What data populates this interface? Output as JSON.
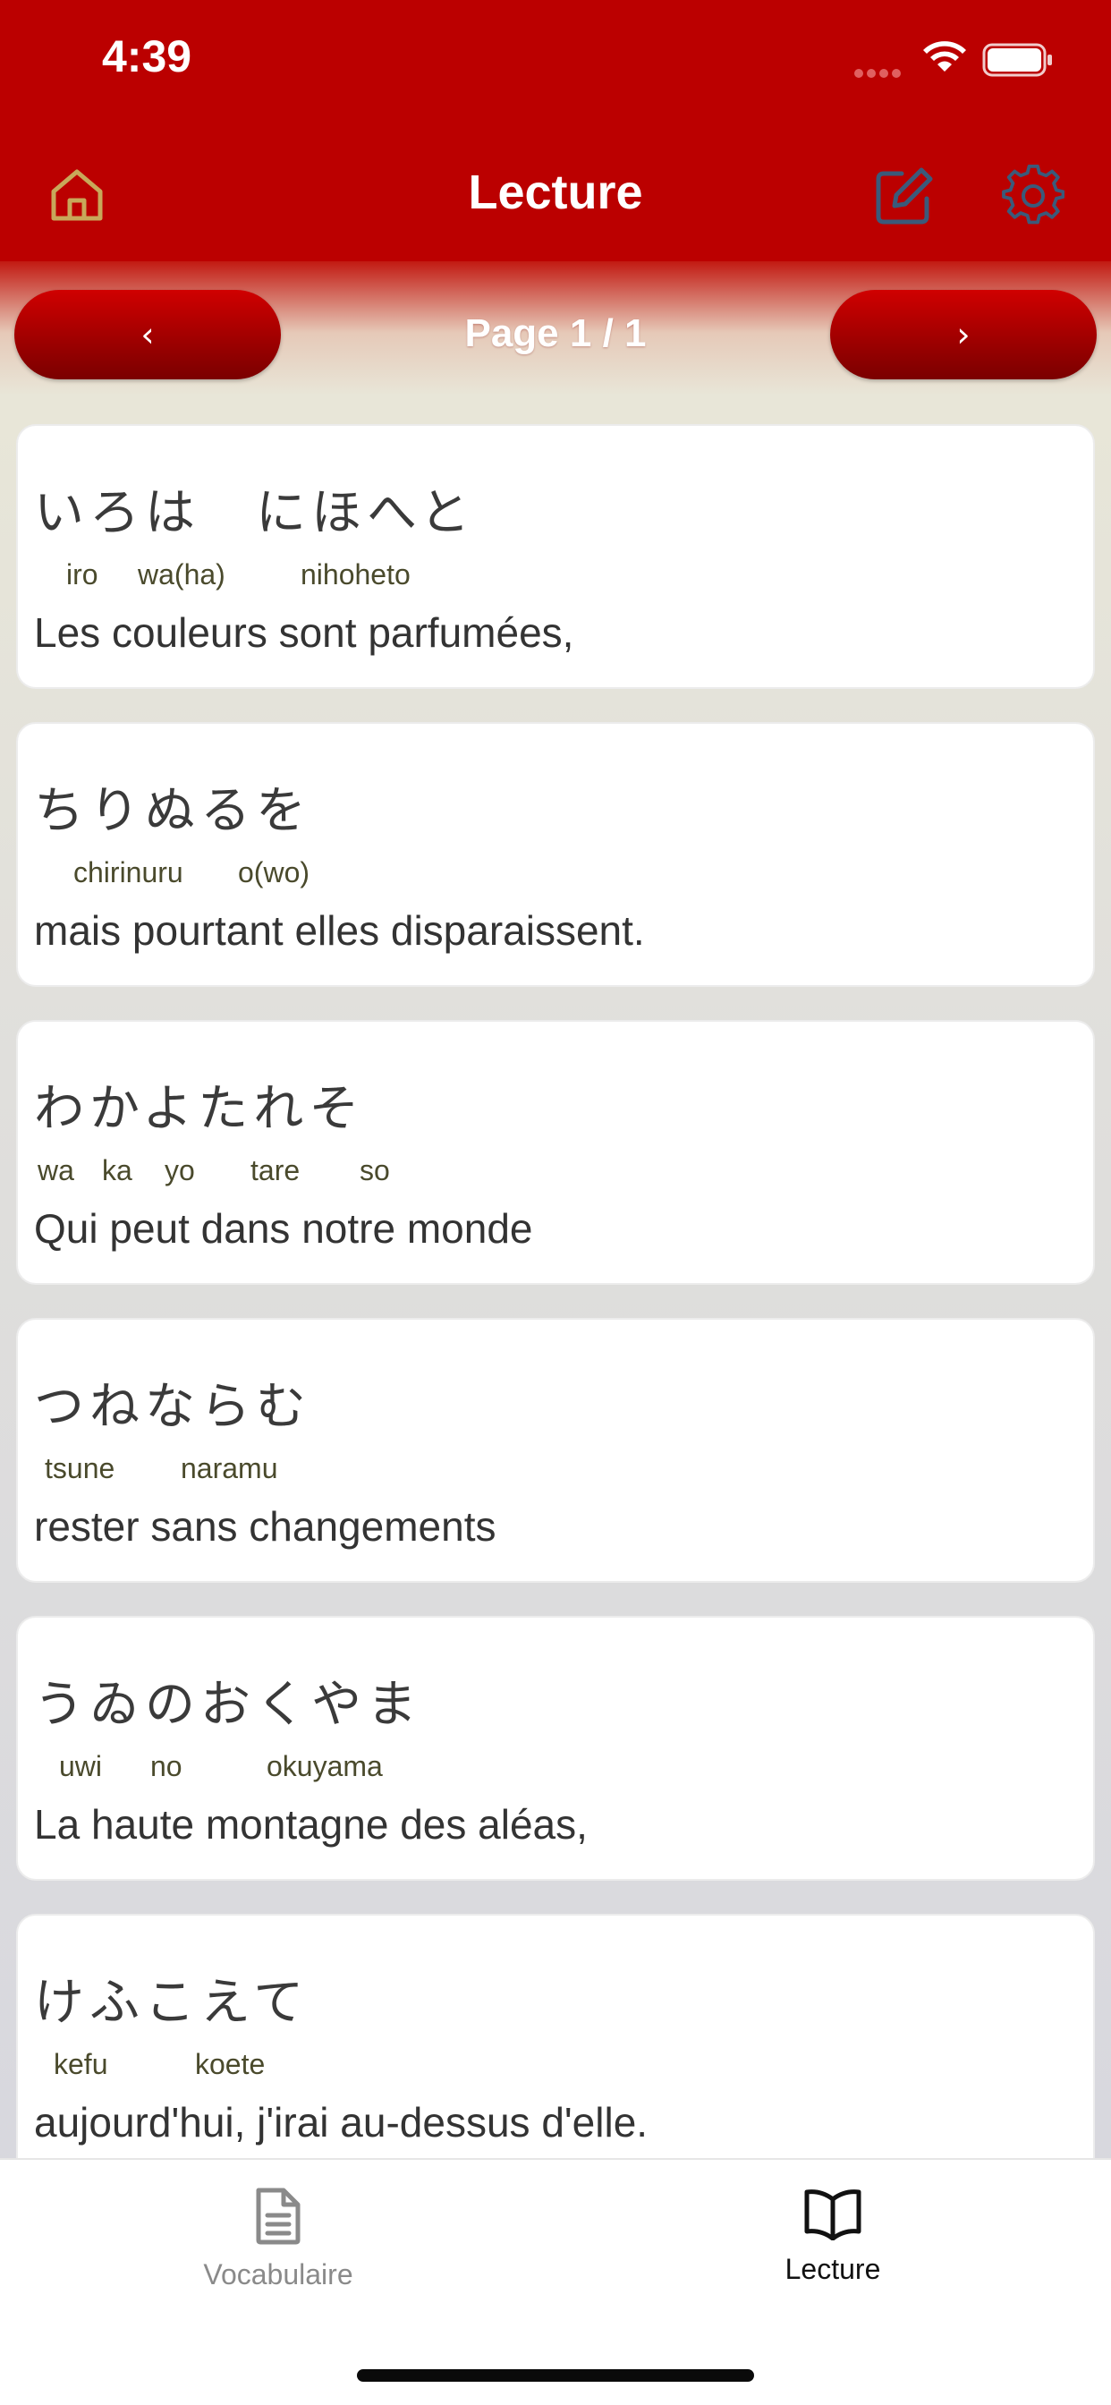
{
  "status_bar": {
    "time": "4:39"
  },
  "header": {
    "title": "Lecture"
  },
  "pager": {
    "prev": "‹",
    "next": "›",
    "label": "Page 1 / 1"
  },
  "cards": [
    {
      "jp": "いろは　にほへと",
      "romaji": [
        "iro",
        "wa(ha)",
        "nihoheto"
      ],
      "fr": "Les couleurs sont parfumées,"
    },
    {
      "jp": "ちりぬるを",
      "romaji": [
        "chirinuru",
        "o(wo)"
      ],
      "fr": "mais pourtant elles disparaissent."
    },
    {
      "jp": "わかよたれそ",
      "romaji": [
        "wa",
        "ka",
        "yo",
        "tare",
        "so"
      ],
      "fr": "Qui peut dans notre monde"
    },
    {
      "jp": "つねならむ",
      "romaji": [
        "tsune",
        "naramu"
      ],
      "fr": "rester sans changements"
    },
    {
      "jp": "うゐのおくやま",
      "romaji": [
        "uwi",
        "no",
        "okuyama"
      ],
      "fr": "La haute montagne des aléas,"
    },
    {
      "jp": "けふこえて",
      "romaji": [
        "kefu",
        "koete"
      ],
      "fr": "aujourd'hui, j'irai au-dessus d'elle."
    }
  ],
  "tabs": [
    {
      "label": "Vocabulaire",
      "icon": "document-icon",
      "active": false
    },
    {
      "label": "Lecture",
      "icon": "book-icon",
      "active": true
    }
  ],
  "colors": {
    "brand_red": "#bb0000",
    "icon_outline": "#c8a85a"
  }
}
